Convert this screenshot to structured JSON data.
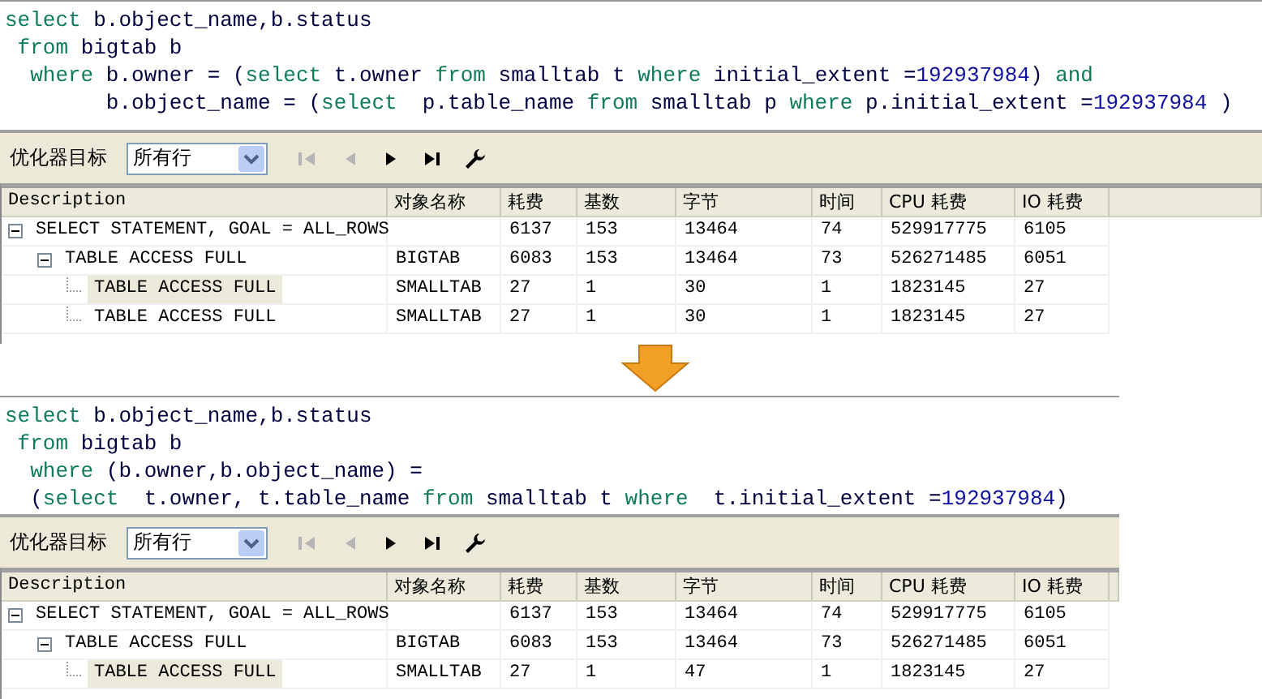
{
  "panels": [
    {
      "sql_lines": [
        {
          "kind": "flush",
          "tokens": [
            {
              "kind": "keyword",
              "text": "select"
            },
            {
              "kind": "text",
              "text": " b.object_name,b.status"
            }
          ]
        },
        {
          "kind": "indent1",
          "tokens": [
            {
              "kind": "keyword",
              "text": "from"
            },
            {
              "kind": "text",
              "text": " bigtab b"
            }
          ]
        },
        {
          "kind": "indent2",
          "tokens": [
            {
              "kind": "keyword",
              "text": "where"
            },
            {
              "kind": "text",
              "text": " b.owner = ("
            },
            {
              "kind": "keyword",
              "text": "select"
            },
            {
              "kind": "text",
              "text": " t.owner "
            },
            {
              "kind": "keyword",
              "text": "from"
            },
            {
              "kind": "text",
              "text": " smalltab t "
            },
            {
              "kind": "keyword",
              "text": "where"
            },
            {
              "kind": "text",
              "text": " initial_extent ="
            },
            {
              "kind": "number",
              "text": "192937984"
            },
            {
              "kind": "text",
              "text": ") "
            },
            {
              "kind": "keyword",
              "text": "and"
            }
          ]
        },
        {
          "kind": "indent8",
          "tokens": [
            {
              "kind": "text",
              "text": "b.object_name = ("
            },
            {
              "kind": "keyword",
              "text": "select"
            },
            {
              "kind": "text",
              "text": "  p.table_name "
            },
            {
              "kind": "keyword",
              "text": "from"
            },
            {
              "kind": "text",
              "text": " smalltab p "
            },
            {
              "kind": "keyword",
              "text": "where"
            },
            {
              "kind": "text",
              "text": " p.initial_extent ="
            },
            {
              "kind": "number",
              "text": "192937984"
            },
            {
              "kind": "text",
              "text": " )"
            }
          ]
        }
      ],
      "toolbar": {
        "label": "优化器目标",
        "dropdown": "所有行",
        "nav": [
          {
            "kind": "first",
            "disabled": true
          },
          {
            "kind": "prev",
            "disabled": true
          },
          {
            "kind": "next",
            "disabled": false
          },
          {
            "kind": "last",
            "disabled": false
          },
          {
            "kind": "wrench",
            "disabled": false
          }
        ]
      },
      "columns": [
        "Description",
        "对象名称",
        "耗费",
        "基数",
        "字节",
        "时间",
        "CPU 耗费",
        "IO 耗费"
      ],
      "rows": [
        {
          "cells": [
            "SELECT STATEMENT, GOAL = ALL_ROWS",
            "",
            "6137",
            "153",
            "13464",
            "74",
            "529917775",
            "6105"
          ],
          "expanded": true,
          "selected": false,
          "children": [
            {
              "cells": [
                "TABLE ACCESS FULL",
                "BIGTAB",
                "6083",
                "153",
                "13464",
                "73",
                "526271485",
                "6051"
              ],
              "expanded": true,
              "selected": false,
              "children": [
                {
                  "cells": [
                    "TABLE ACCESS FULL",
                    "SMALLTAB",
                    "27",
                    "1",
                    "30",
                    "1",
                    "1823145",
                    "27"
                  ],
                  "selected": true
                },
                {
                  "cells": [
                    "TABLE ACCESS FULL",
                    "SMALLTAB",
                    "27",
                    "1",
                    "30",
                    "1",
                    "1823145",
                    "27"
                  ],
                  "selected": false
                }
              ]
            }
          ]
        }
      ]
    },
    {
      "sql_lines": [
        {
          "kind": "flush",
          "tokens": [
            {
              "kind": "keyword",
              "text": "select"
            },
            {
              "kind": "text",
              "text": " b.object_name,b.status"
            }
          ]
        },
        {
          "kind": "indent1",
          "tokens": [
            {
              "kind": "keyword",
              "text": "from"
            },
            {
              "kind": "text",
              "text": " bigtab b"
            }
          ]
        },
        {
          "kind": "indent2",
          "tokens": [
            {
              "kind": "keyword",
              "text": "where"
            },
            {
              "kind": "text",
              "text": " (b.owner,b.object_name) ="
            }
          ]
        },
        {
          "kind": "indent2",
          "tokens": [
            {
              "kind": "text",
              "text": "("
            },
            {
              "kind": "keyword",
              "text": "select"
            },
            {
              "kind": "text",
              "text": "  t.owner, t.table_name "
            },
            {
              "kind": "keyword",
              "text": "from"
            },
            {
              "kind": "text",
              "text": " smalltab t "
            },
            {
              "kind": "keyword",
              "text": "where"
            },
            {
              "kind": "text",
              "text": "  t.initial_extent ="
            },
            {
              "kind": "number",
              "text": "192937984"
            },
            {
              "kind": "text",
              "text": ")"
            }
          ]
        }
      ],
      "toolbar": {
        "label": "优化器目标",
        "dropdown": "所有行",
        "nav": [
          {
            "kind": "first",
            "disabled": true
          },
          {
            "kind": "prev",
            "disabled": true
          },
          {
            "kind": "next",
            "disabled": false
          },
          {
            "kind": "last",
            "disabled": false
          },
          {
            "kind": "wrench",
            "disabled": false
          }
        ]
      },
      "columns": [
        "Description",
        "对象名称",
        "耗费",
        "基数",
        "字节",
        "时间",
        "CPU 耗费",
        "IO 耗费"
      ],
      "rows": [
        {
          "cells": [
            "SELECT STATEMENT, GOAL = ALL_ROWS",
            "",
            "6137",
            "153",
            "13464",
            "74",
            "529917775",
            "6105"
          ],
          "expanded": true,
          "selected": false,
          "children": [
            {
              "cells": [
                "TABLE ACCESS FULL",
                "BIGTAB",
                "6083",
                "153",
                "13464",
                "73",
                "526271485",
                "6051"
              ],
              "expanded": true,
              "selected": false,
              "children": [
                {
                  "cells": [
                    "TABLE ACCESS FULL",
                    "SMALLTAB",
                    "27",
                    "1",
                    "47",
                    "1",
                    "1823145",
                    "27"
                  ],
                  "selected": true
                }
              ]
            }
          ]
        }
      ]
    }
  ]
}
